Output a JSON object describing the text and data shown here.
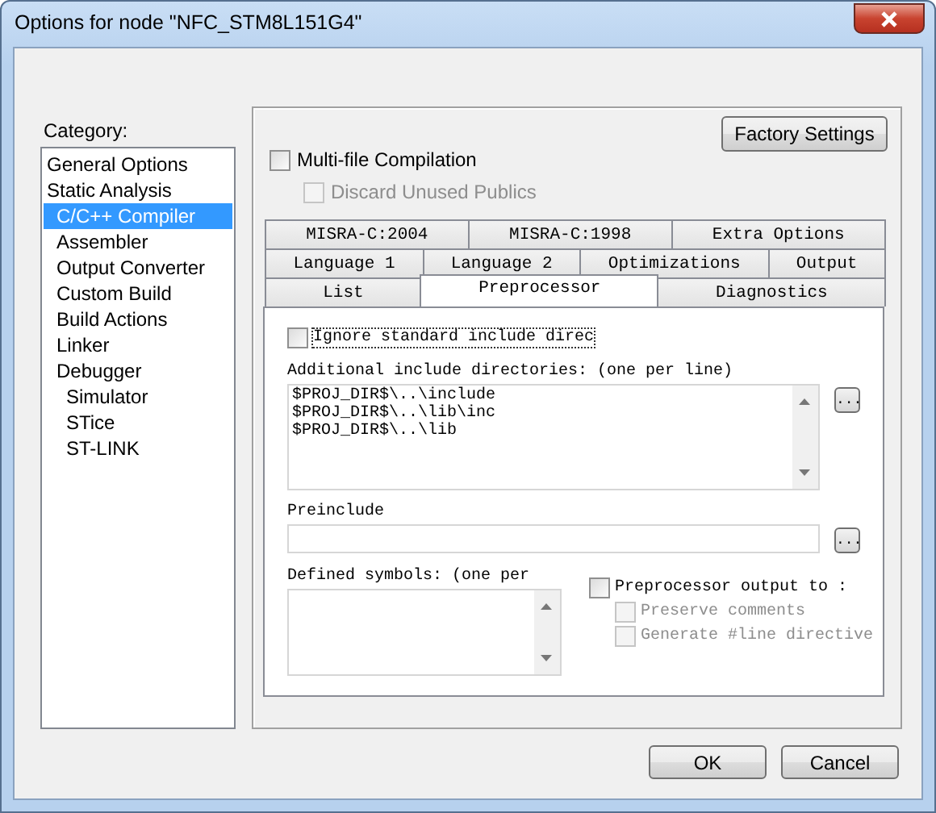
{
  "window": {
    "title": "Options for node \"NFC_STM8L151G4\""
  },
  "category": {
    "label": "Category:",
    "items": [
      {
        "label": "General Options",
        "selected": false
      },
      {
        "label": "Static Analysis",
        "selected": false,
        "children": [
          {
            "label": "C/C++ Compiler",
            "selected": true
          },
          {
            "label": "Assembler",
            "selected": false
          },
          {
            "label": "Output Converter",
            "selected": false
          },
          {
            "label": "Custom Build",
            "selected": false
          },
          {
            "label": "Build Actions",
            "selected": false
          },
          {
            "label": "Linker",
            "selected": false
          },
          {
            "label": "Debugger",
            "selected": false,
            "children": [
              {
                "label": "Simulator",
                "selected": false
              },
              {
                "label": "STice",
                "selected": false
              },
              {
                "label": "ST-LINK",
                "selected": false
              }
            ]
          }
        ]
      }
    ]
  },
  "factory_settings": "Factory Settings",
  "multi_file": {
    "label": "Multi-file Compilation",
    "checked": false,
    "disabled": false
  },
  "discard_unused": {
    "label": "Discard Unused Publics",
    "checked": false,
    "disabled": true
  },
  "tab_rows": [
    [
      {
        "label": "MISRA-C:2004",
        "selected": false
      },
      {
        "label": "MISRA-C:1998",
        "selected": false
      },
      {
        "label": "Extra Options",
        "selected": false
      }
    ],
    [
      {
        "label": "Language 1",
        "selected": false
      },
      {
        "label": "Language 2",
        "selected": false
      },
      {
        "label": "Optimizations",
        "selected": false
      },
      {
        "label": "Output",
        "selected": false
      }
    ],
    [
      {
        "label": "List",
        "selected": false
      },
      {
        "label": "Preprocessor",
        "selected": true
      },
      {
        "label": "Diagnostics",
        "selected": false
      }
    ]
  ],
  "preprocessor": {
    "ignore_standard": {
      "label": "Ignore standard include direc",
      "checked": false,
      "disabled": false
    },
    "include_label": "Additional include directories: (one per line)",
    "include_dirs": [
      "$PROJ_DIR$\\..\\include",
      "$PROJ_DIR$\\..\\lib\\inc",
      "$PROJ_DIR$\\..\\lib"
    ],
    "include_browse": "...",
    "preinclude_label": "Preinclude",
    "preinclude_browse": "...",
    "defined_label": "Defined symbols: (one per",
    "output": {
      "label": "Preprocessor output to :",
      "checked": false,
      "disabled": false
    },
    "output_options": [
      {
        "label": "Preserve comments",
        "checked": false,
        "disabled": true
      },
      {
        "label": "Generate #line directive",
        "checked": false,
        "disabled": true
      }
    ]
  },
  "buttons": [
    {
      "label": "OK"
    },
    {
      "label": "Cancel"
    }
  ]
}
